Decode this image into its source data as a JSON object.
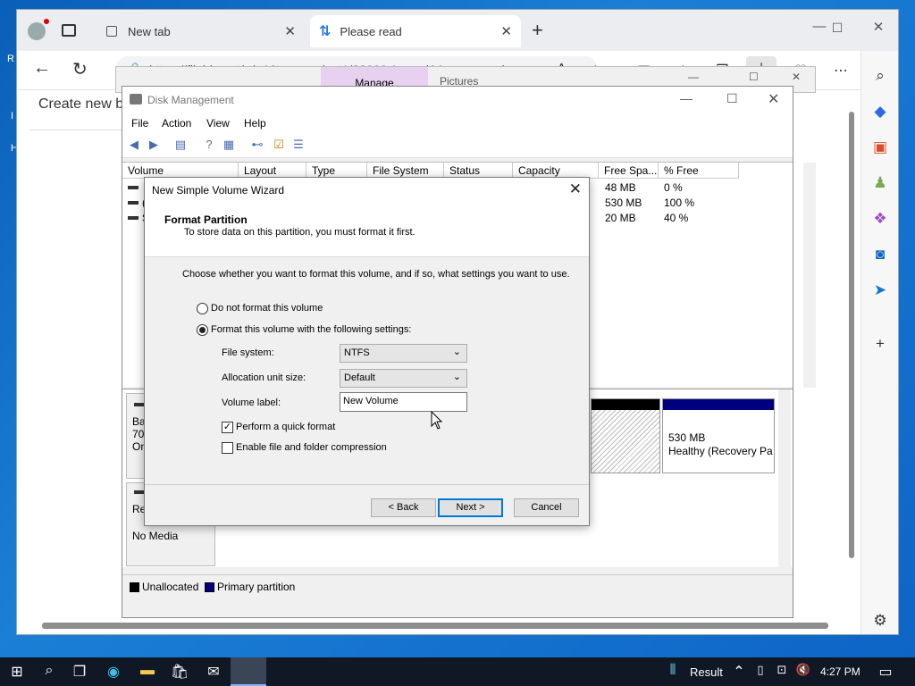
{
  "desktop": {
    "left_letters": [
      "R",
      "I",
      "H"
    ]
  },
  "browser": {
    "tabs": [
      {
        "label": "New tab"
      },
      {
        "label": "Please read"
      }
    ],
    "url": "https://filebin.net/win10teamproject1/22000.1_amd64_en-us_ppipro ...",
    "page_text": "Create new b",
    "new_tab_symbol": "+"
  },
  "bg_window": {
    "manage_tab": "Manage",
    "pictures_tab": "Pictures"
  },
  "disk_management": {
    "title": "Disk Management",
    "menu": [
      "File",
      "Action",
      "View",
      "Help"
    ],
    "columns": [
      "Volume",
      "Layout",
      "Type",
      "File System",
      "Status",
      "Capacity",
      "Free Spa...",
      "% Free"
    ],
    "rows": [
      {
        "volume": "",
        "free": "48 MB",
        "pct": "0 %"
      },
      {
        "volume": "(",
        "free": "530 MB",
        "pct": "100 %"
      },
      {
        "volume": "S",
        "free": "20 MB",
        "pct": "40 %"
      }
    ],
    "disk0": {
      "name": "Bas",
      "size": "70.",
      "status": "On"
    },
    "disk1": {
      "name": "Re",
      "media": "No Media"
    },
    "partition_recovery": {
      "size": "530 MB",
      "status": "Healthy (Recovery Pa"
    },
    "legend": [
      {
        "label": "Unallocated",
        "color": "#000000"
      },
      {
        "label": "Primary partition",
        "color": "#00007f"
      }
    ]
  },
  "wizard": {
    "title": "New Simple Volume Wizard",
    "heading": "Format Partition",
    "subheading": "To store data on this partition, you must format it first.",
    "prompt": "Choose whether you want to format this volume, and if so, what settings you want to use.",
    "option_no_format": "Do not format this volume",
    "option_format": "Format this volume with the following settings:",
    "selected_option": "format",
    "file_system_label": "File system:",
    "file_system_value": "NTFS",
    "alloc_label": "Allocation unit size:",
    "alloc_value": "Default",
    "volume_label_label": "Volume label:",
    "volume_label_value": "New Volume",
    "quick_format_label": "Perform a quick format",
    "quick_format_checked": true,
    "compression_label": "Enable file and folder compression",
    "compression_checked": false,
    "back_button": "< Back",
    "next_button": "Next >",
    "cancel_button": "Cancel"
  },
  "taskbar": {
    "tray_label": "Result",
    "time": "4:27 PM"
  }
}
